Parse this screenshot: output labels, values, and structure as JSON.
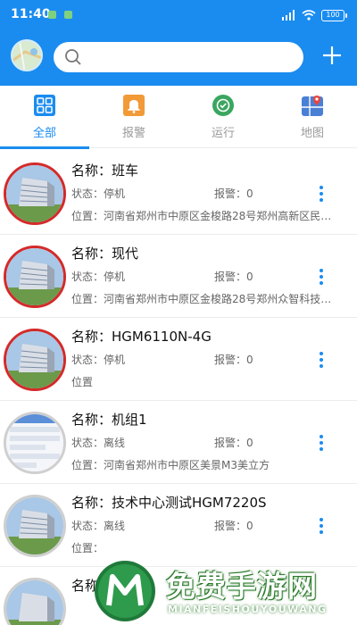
{
  "status_bar": {
    "time": "11:40",
    "battery": "100"
  },
  "header": {
    "search": {
      "placeholder": "",
      "value": ""
    }
  },
  "tabs": [
    {
      "label": "全部",
      "icon": "grid-icon",
      "active": true
    },
    {
      "label": "报警",
      "icon": "bell-icon",
      "active": false
    },
    {
      "label": "运行",
      "icon": "check-circle-icon",
      "active": false
    },
    {
      "label": "地图",
      "icon": "map-icon",
      "active": false
    }
  ],
  "devices": [
    {
      "name": "名称：班车",
      "state": "状态：停机",
      "alarm": "报警：0",
      "location": "位置：河南省郑州市中原区金梭路28号郑州高新区民…",
      "thumb": "building-photo-icon"
    },
    {
      "name": "名称：现代",
      "state": "状态：停机",
      "alarm": "报警：0",
      "location": "位置：河南省郑州市中原区金梭路28号郑州众智科技…",
      "thumb": "building-photo-icon"
    },
    {
      "name": "名称：HGM6110N-4G",
      "state": "状态：停机",
      "alarm": "报警：0",
      "location": "位置",
      "thumb": "building-photo-icon"
    },
    {
      "name": "名称：机组1",
      "state": "状态：离线",
      "alarm": "报警：0",
      "location": "位置：河南省郑州市中原区美景M3美立方",
      "thumb": "screenshot-icon"
    },
    {
      "name": "名称：技术中心测试HGM7220S",
      "state": "状态：离线",
      "alarm": "报警：0",
      "location": "位置：",
      "thumb": "building-photo-icon"
    },
    {
      "name": "名称：",
      "state": "",
      "alarm": "",
      "location": "",
      "thumb": "building-photo-icon"
    }
  ],
  "watermark": {
    "text": "免费手游网",
    "subtext": "MIANFEISHOUYOUWANG"
  },
  "colors": {
    "primary": "#1a8cf0",
    "alarm_orange": "#f29a38",
    "run_green": "#3aa65f",
    "online_ring": "#d42a2a",
    "offline_ring": "#cfcfcf"
  }
}
